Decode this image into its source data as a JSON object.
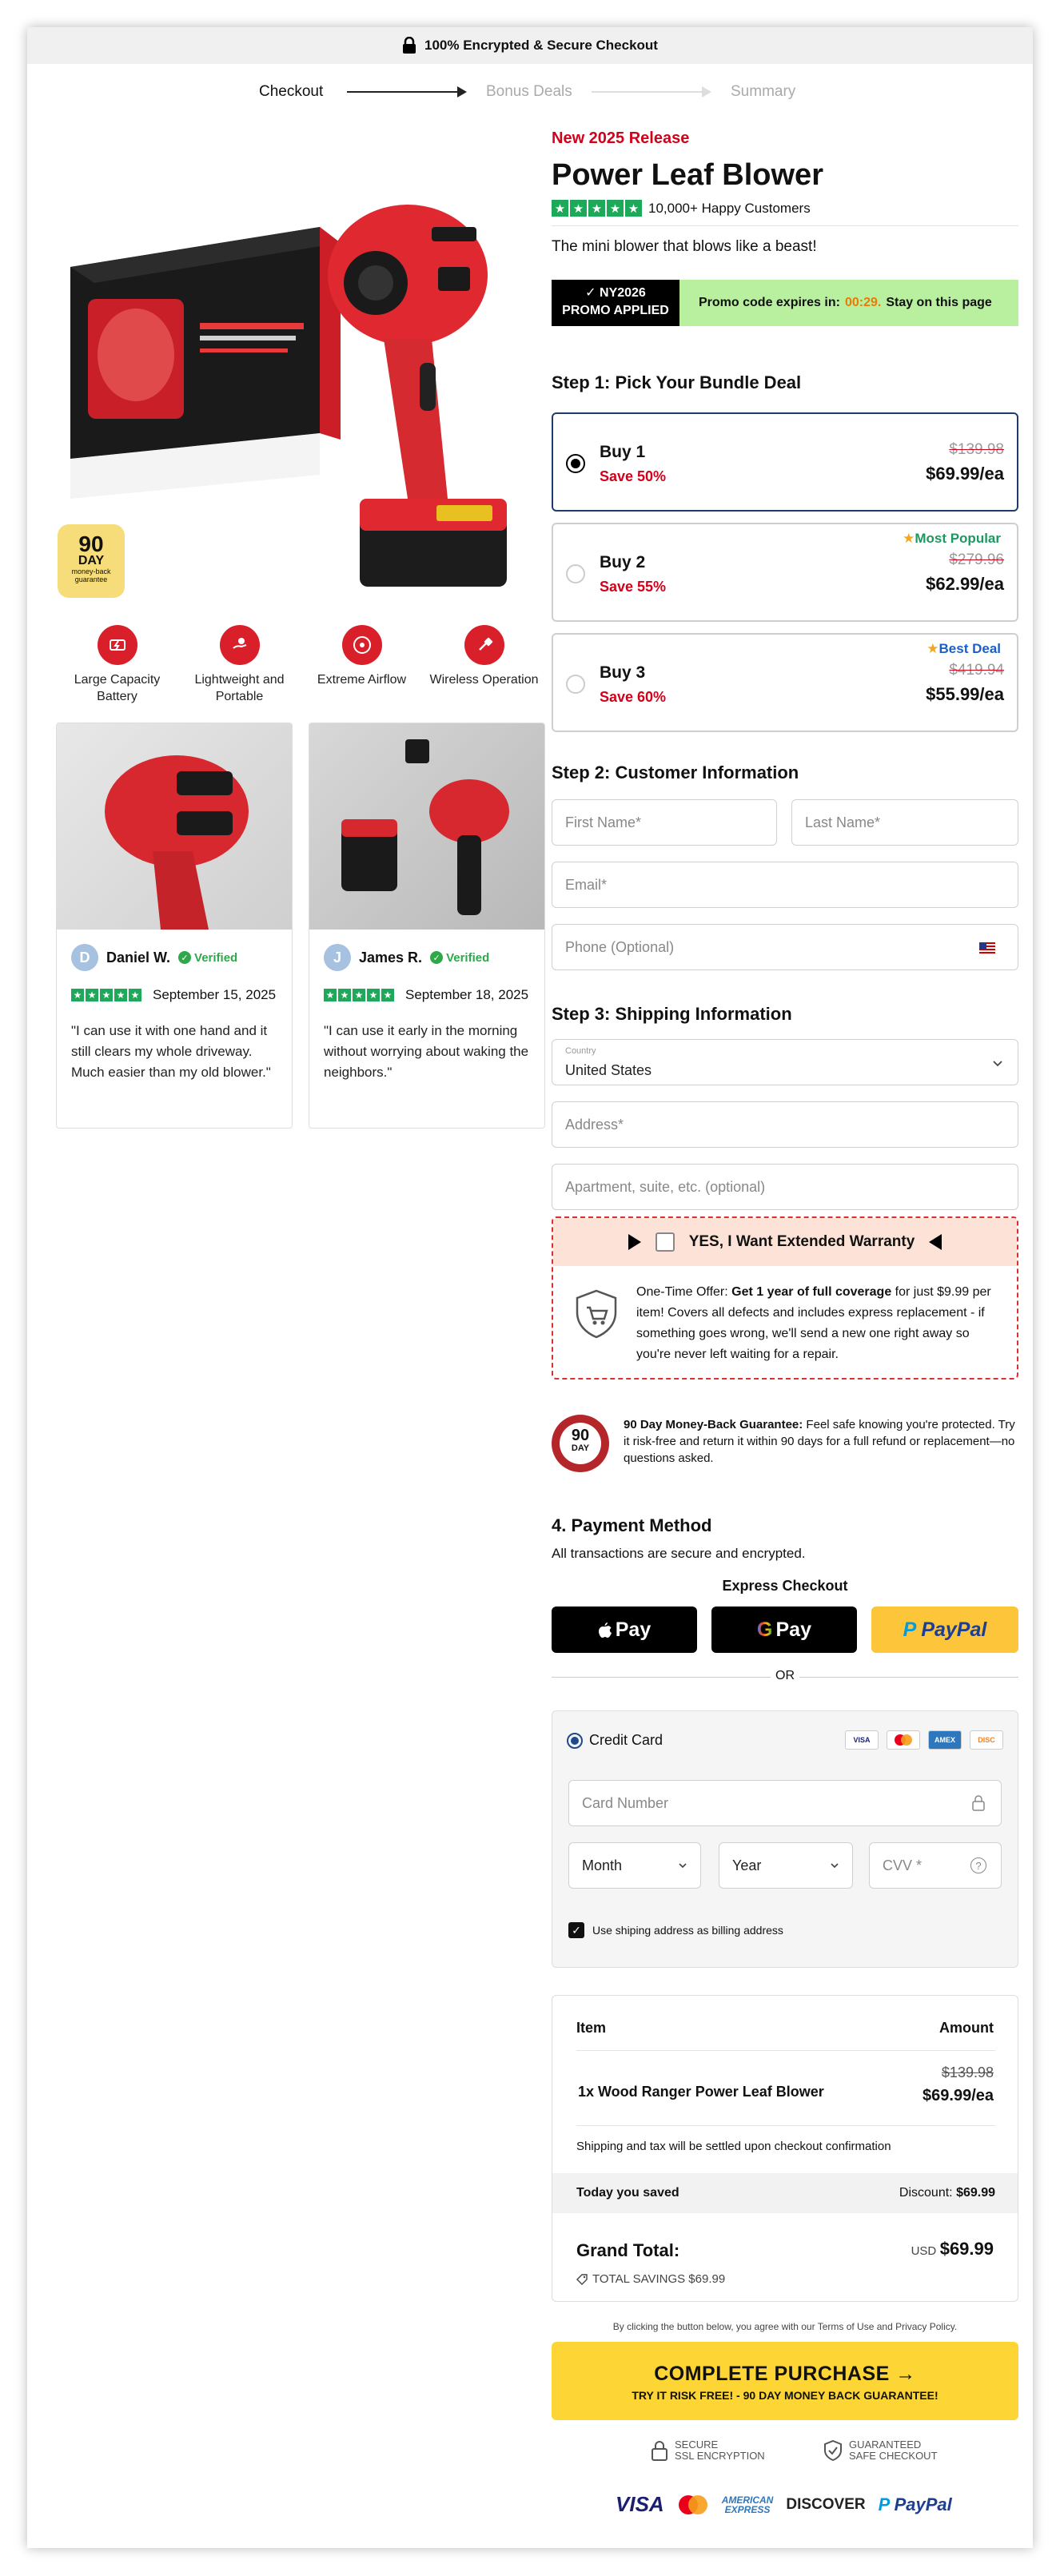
{
  "topbar": {
    "text": "100% Encrypted & Secure Checkout"
  },
  "stepper": {
    "step1": "Checkout",
    "step2": "Bonus Deals",
    "step3": "Summary"
  },
  "guarantee_badge": {
    "num": "90",
    "unit": "DAY",
    "text": "money-back guarantee"
  },
  "features": [
    {
      "label": "Large Capacity Battery",
      "icon": "battery-icon"
    },
    {
      "label": "Lightweight and Portable",
      "icon": "hand-icon"
    },
    {
      "label": "Extreme Airflow",
      "icon": "fan-icon"
    },
    {
      "label": "Wireless Operation",
      "icon": "plug-icon"
    }
  ],
  "reviews": [
    {
      "initial": "D",
      "name": "Daniel W.",
      "verified": "Verified",
      "date": "September 15, 2025",
      "quote": "\"I can use it with one hand and it still clears my whole driveway. Much easier than my old blower.\""
    },
    {
      "initial": "J",
      "name": "James R.",
      "verified": "Verified",
      "date": "September 18, 2025",
      "quote": "\"I can use it early in the morning without worrying about waking the neighbors.\""
    }
  ],
  "product": {
    "new_label": "New 2025 Release",
    "title": "Power Leaf Blower",
    "rating_text": "10,000+ Happy Customers",
    "tagline": "The mini blower that blows like a beast!"
  },
  "promo": {
    "code": "✓ NY2026",
    "applied": "PROMO APPLIED",
    "expires_label": "Promo code expires in:",
    "timer": "00:29.",
    "stay": "Stay on this page"
  },
  "step1": {
    "title": "Step 1: Pick Your Bundle Deal",
    "bundles": [
      {
        "name": "Buy 1",
        "save": "Save 50%",
        "old": "$139.98",
        "price": "$69.99/ea",
        "tag": ""
      },
      {
        "name": "Buy 2",
        "save": "Save 55%",
        "old": "$279.96",
        "price": "$62.99/ea",
        "tag": "Most Popular"
      },
      {
        "name": "Buy 3",
        "save": "Save 60%",
        "old": "$419.94",
        "price": "$55.99/ea",
        "tag": "Best Deal"
      }
    ]
  },
  "step2": {
    "title": "Step 2: Customer Information",
    "first_name": "First Name*",
    "last_name": "Last Name*",
    "email": "Email*",
    "phone": "Phone (Optional)"
  },
  "step3": {
    "title": "Step 3: Shipping Information",
    "country_label": "Country",
    "country_value": "United States",
    "address": "Address*",
    "apartment": "Apartment, suite, etc. (optional)"
  },
  "warranty": {
    "header": "YES, I Want Extended Warranty",
    "text_a": "One-Time Offer: ",
    "text_b": "Get 1 year of full coverage",
    "text_c": " for just $9.99 per item! Covers all defects and includes express replacement - if something goes wrong, we'll send a new one right away so you're never left waiting for a repair."
  },
  "money_back": {
    "seal_num": "90",
    "seal_unit": "DAY",
    "bold": "90 Day Money-Back Guarantee:",
    "text": " Feel safe knowing you're protected. Try it risk-free and return it within 90 days for a full refund or replacement—no questions asked."
  },
  "payment": {
    "title": "4. Payment Method",
    "subtitle": "All transactions are secure and encrypted.",
    "express": "Express Checkout",
    "apple": "Pay",
    "google": "Pay",
    "paypal": "PayPal",
    "or": "OR",
    "credit_card": "Credit Card",
    "card_logos": [
      "VISA",
      "MC",
      "AMEX",
      "DISC"
    ],
    "card_number": "Card Number",
    "month": "Month",
    "year": "Year",
    "cvv": "CVV *",
    "billing_same": "Use shiping address as billing address"
  },
  "summary": {
    "col_item": "Item",
    "col_amount": "Amount",
    "item": "1x Wood Ranger Power Leaf Blower",
    "item_old": "$139.98",
    "item_price": "$69.99/ea",
    "shipping_note": "Shipping and tax will be settled upon checkout confirmation",
    "saved_label": "Today you saved",
    "discount_label": "Discount:",
    "discount_value": "$69.99",
    "grand_label": "Grand Total:",
    "currency": "USD",
    "grand_value": "$69.99",
    "total_savings": "TOTAL SAVINGS $69.99"
  },
  "terms": "By clicking the button below, you agree with our Terms of Use and Privacy Policy.",
  "cta": {
    "main": "COMPLETE PURCHASE →",
    "sub": "TRY IT RISK FREE! - 90 DAY MONEY BACK GUARANTEE!"
  },
  "trust": {
    "ssl_a": "SECURE",
    "ssl_b": "SSL ENCRYPTION",
    "safe_a": "GUARANTEED",
    "safe_b": "SAFE CHECKOUT"
  },
  "footer_logos": {
    "visa": "VISA",
    "amex_a": "AMERICAN",
    "amex_b": "EXPRESS",
    "discover": "DISCOVER",
    "paypal": "PayPal"
  },
  "colors": {
    "brand_red": "#d0021b",
    "accent_yellow": "#fdd635",
    "promo_green": "#b8f0a0",
    "star_green": "#1ea85a"
  }
}
